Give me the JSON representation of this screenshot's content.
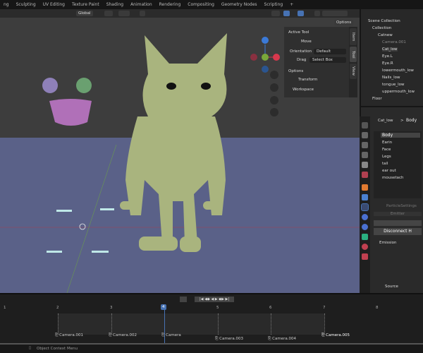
{
  "workspaces": [
    "ng",
    "Sculpting",
    "UV Editing",
    "Texture Paint",
    "Shading",
    "Animation",
    "Rendering",
    "Compositing",
    "Geometry Nodes",
    "Scripting",
    "+"
  ],
  "viewport_header": {
    "orientation": "Global",
    "options": "Options"
  },
  "n_panel": {
    "tabs": [
      "Item",
      "Tool",
      "View"
    ],
    "active_tool": "Active Tool",
    "tool": "Move",
    "orientation_label": "Orientation",
    "orientation_value": "Default",
    "drag_label": "Drag",
    "drag_value": "Select Box",
    "options": "Options",
    "transform": "Transform",
    "workspace": "Workspace"
  },
  "outliner": {
    "items": [
      {
        "name": "Scene Collection"
      },
      {
        "name": "Collection"
      },
      {
        "name": "Catnew"
      },
      {
        "name": "Camera.001"
      },
      {
        "name": "Cat_low"
      },
      {
        "name": "Eye.L"
      },
      {
        "name": "Eye.R"
      },
      {
        "name": "lowermouth_low"
      },
      {
        "name": "Nails_low"
      },
      {
        "name": "tongue_low"
      },
      {
        "name": "uppermouth_low"
      },
      {
        "name": "Floor"
      }
    ]
  },
  "properties": {
    "object": "Cat_low",
    "breadcrumb_sep": ">",
    "data": "Body",
    "particle_systems": [
      "Body",
      "Earin",
      "Face",
      "Legs",
      "tail",
      "ear out",
      "mousetach"
    ],
    "settings_name": "ParticleSettings",
    "type": "Emitter",
    "disconnect": "Disconnect H",
    "emission": "Emission",
    "source": "Source",
    "accent": "#4772b3"
  },
  "timeline": {
    "frames": [
      "1",
      "2",
      "3",
      "4",
      "5",
      "6",
      "7",
      "8"
    ],
    "current_frame": "4",
    "markers": [
      "Camera.001",
      "Camera.002",
      "Camera",
      "Camera.003",
      "Camera.004",
      "Camera.005"
    ]
  },
  "status": {
    "hint": "Object Context Menu"
  }
}
